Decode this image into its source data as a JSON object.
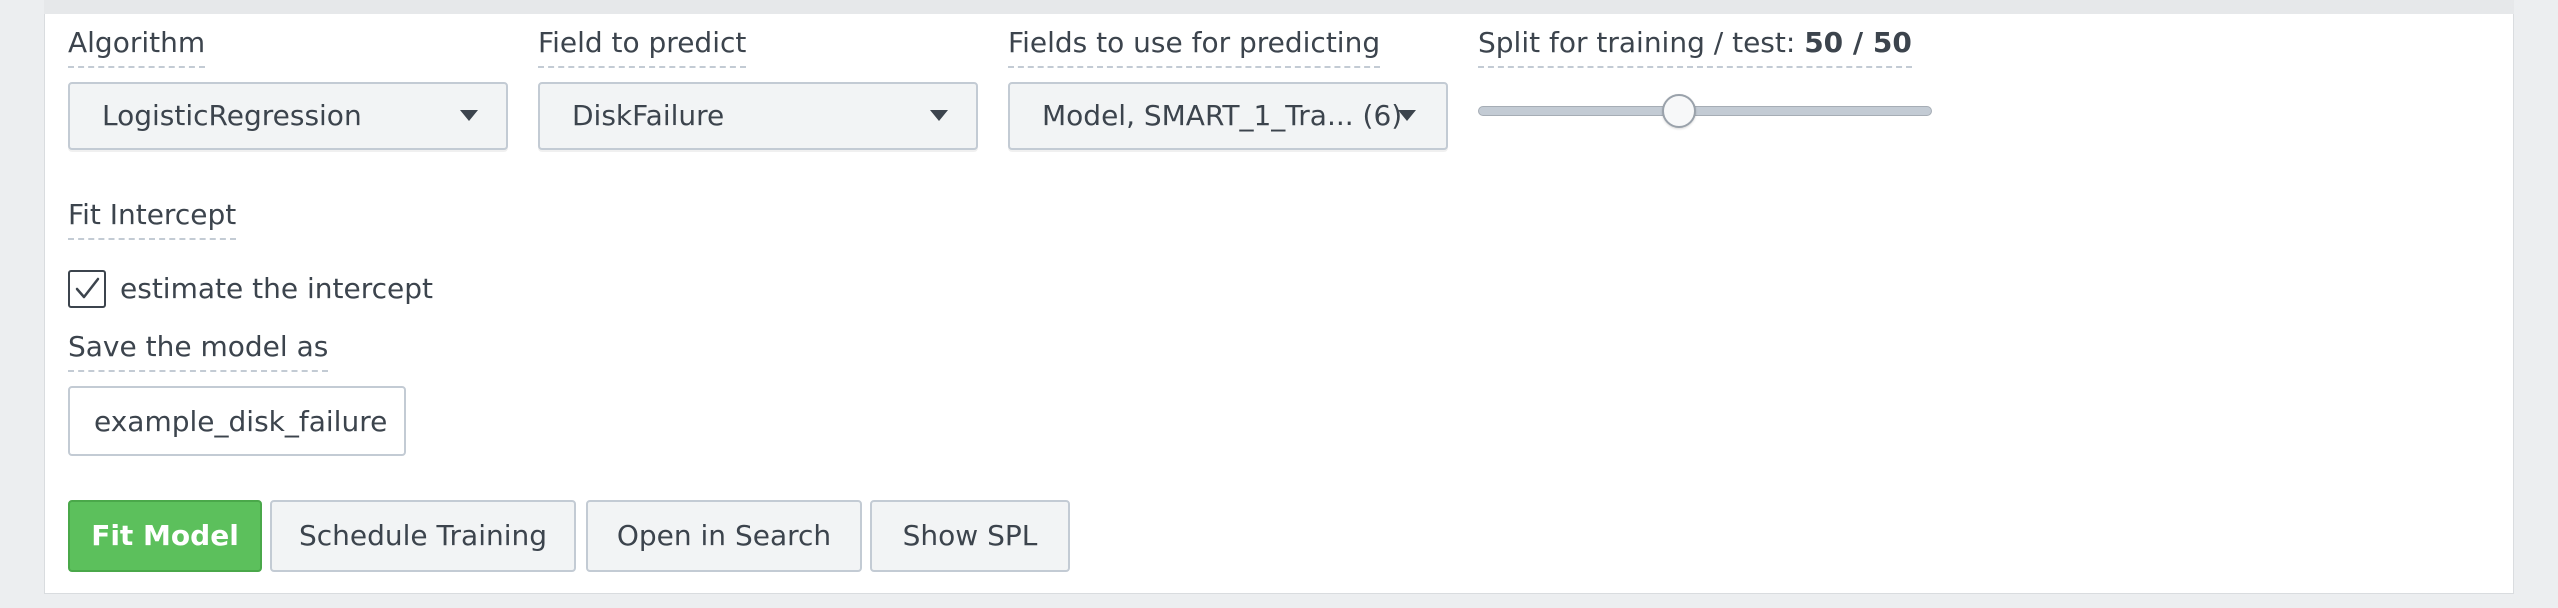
{
  "form": {
    "algorithm": {
      "label": "Algorithm",
      "value": "LogisticRegression"
    },
    "field_to_predict": {
      "label": "Field to predict",
      "value": "DiskFailure"
    },
    "fields_for_predicting": {
      "label": "Fields to use for predicting",
      "value": "Model, SMART_1_Tra... (6)"
    },
    "split": {
      "label": "Split for training / test:",
      "value_text": "50 / 50",
      "training_percent": 50
    },
    "fit_intercept": {
      "label": "Fit Intercept",
      "checkbox_label": "estimate the intercept",
      "checked": true
    },
    "save_model": {
      "label": "Save the model as",
      "value": "example_disk_failure"
    }
  },
  "buttons": {
    "fit_model": "Fit Model",
    "schedule_training": "Schedule Training",
    "open_in_search": "Open in Search",
    "show_spl": "Show SPL"
  },
  "icons": {
    "dropdown_caret": "caret-down-icon",
    "checkbox_check": "checkmark-icon"
  },
  "colors": {
    "primary_button": "#5cc05c",
    "text": "#3c444d",
    "border": "#c3cbd4"
  }
}
